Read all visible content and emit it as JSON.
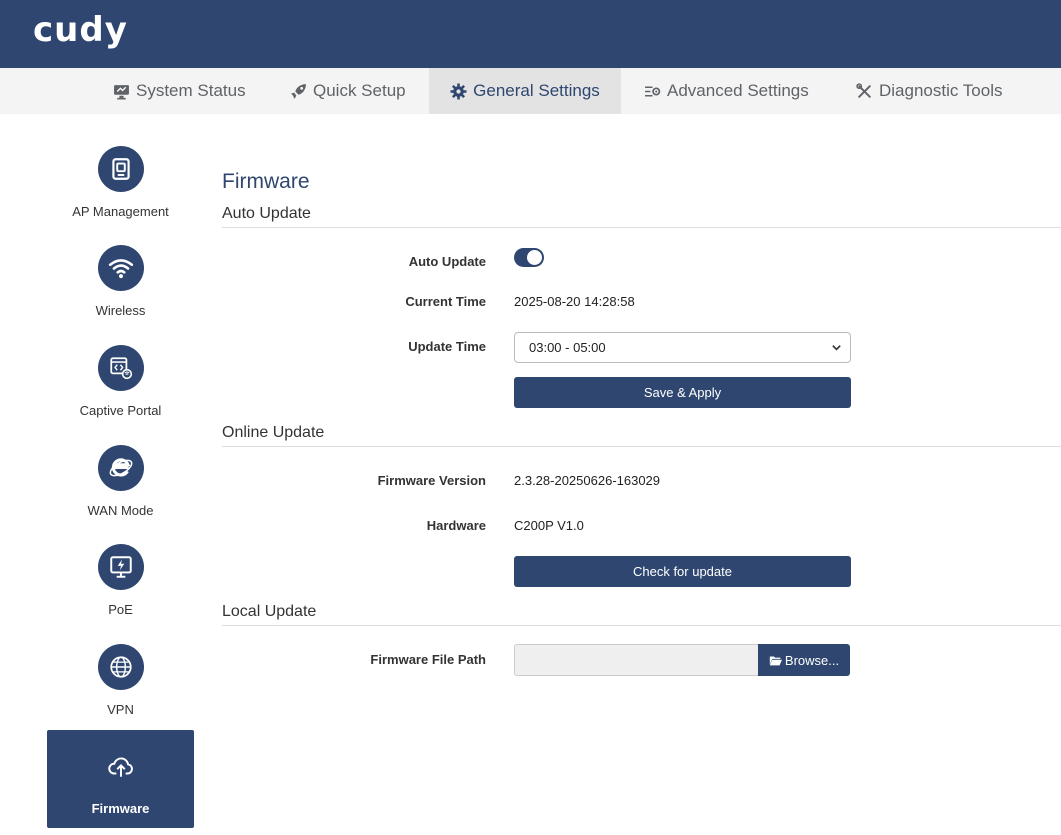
{
  "brand": {
    "logo": "cudy"
  },
  "nav": {
    "items": [
      {
        "label": "System Status",
        "icon": "monitor-icon"
      },
      {
        "label": "Quick Setup",
        "icon": "rocket-icon"
      },
      {
        "label": "General Settings",
        "icon": "gear-icon",
        "active": true
      },
      {
        "label": "Advanced Settings",
        "icon": "advanced-settings-icon"
      },
      {
        "label": "Diagnostic Tools",
        "icon": "tools-icon"
      }
    ]
  },
  "sidebar": {
    "items": [
      {
        "label": "AP Management",
        "icon": "ap-device-icon"
      },
      {
        "label": "Wireless",
        "icon": "wifi-icon"
      },
      {
        "label": "Captive Portal",
        "icon": "captive-portal-icon"
      },
      {
        "label": "WAN Mode",
        "icon": "wan-mode-icon"
      },
      {
        "label": "PoE",
        "icon": "poe-icon"
      },
      {
        "label": "VPN",
        "icon": "globe-icon"
      },
      {
        "label": "Firmware",
        "icon": "cloud-upload-icon",
        "active": true
      }
    ]
  },
  "page": {
    "title": "Firmware",
    "auto_update": {
      "heading": "Auto Update",
      "toggle_label": "Auto Update",
      "toggle_on": true,
      "current_time_label": "Current Time",
      "current_time": "2025-08-20 14:28:58",
      "update_time_label": "Update Time",
      "update_time_value": "03:00 - 05:00",
      "save_label": "Save & Apply"
    },
    "online_update": {
      "heading": "Online Update",
      "firmware_version_label": "Firmware Version",
      "firmware_version": "2.3.28-20250626-163029",
      "hardware_label": "Hardware",
      "hardware": "C200P V1.0",
      "check_label": "Check for update"
    },
    "local_update": {
      "heading": "Local Update",
      "file_path_label": "Firmware File Path",
      "file_path_value": "",
      "browse_label": "Browse..."
    }
  },
  "colors": {
    "primary": "#2f4770",
    "nav_bg": "#f4f4f4",
    "nav_active_bg": "#e3e3e3"
  }
}
